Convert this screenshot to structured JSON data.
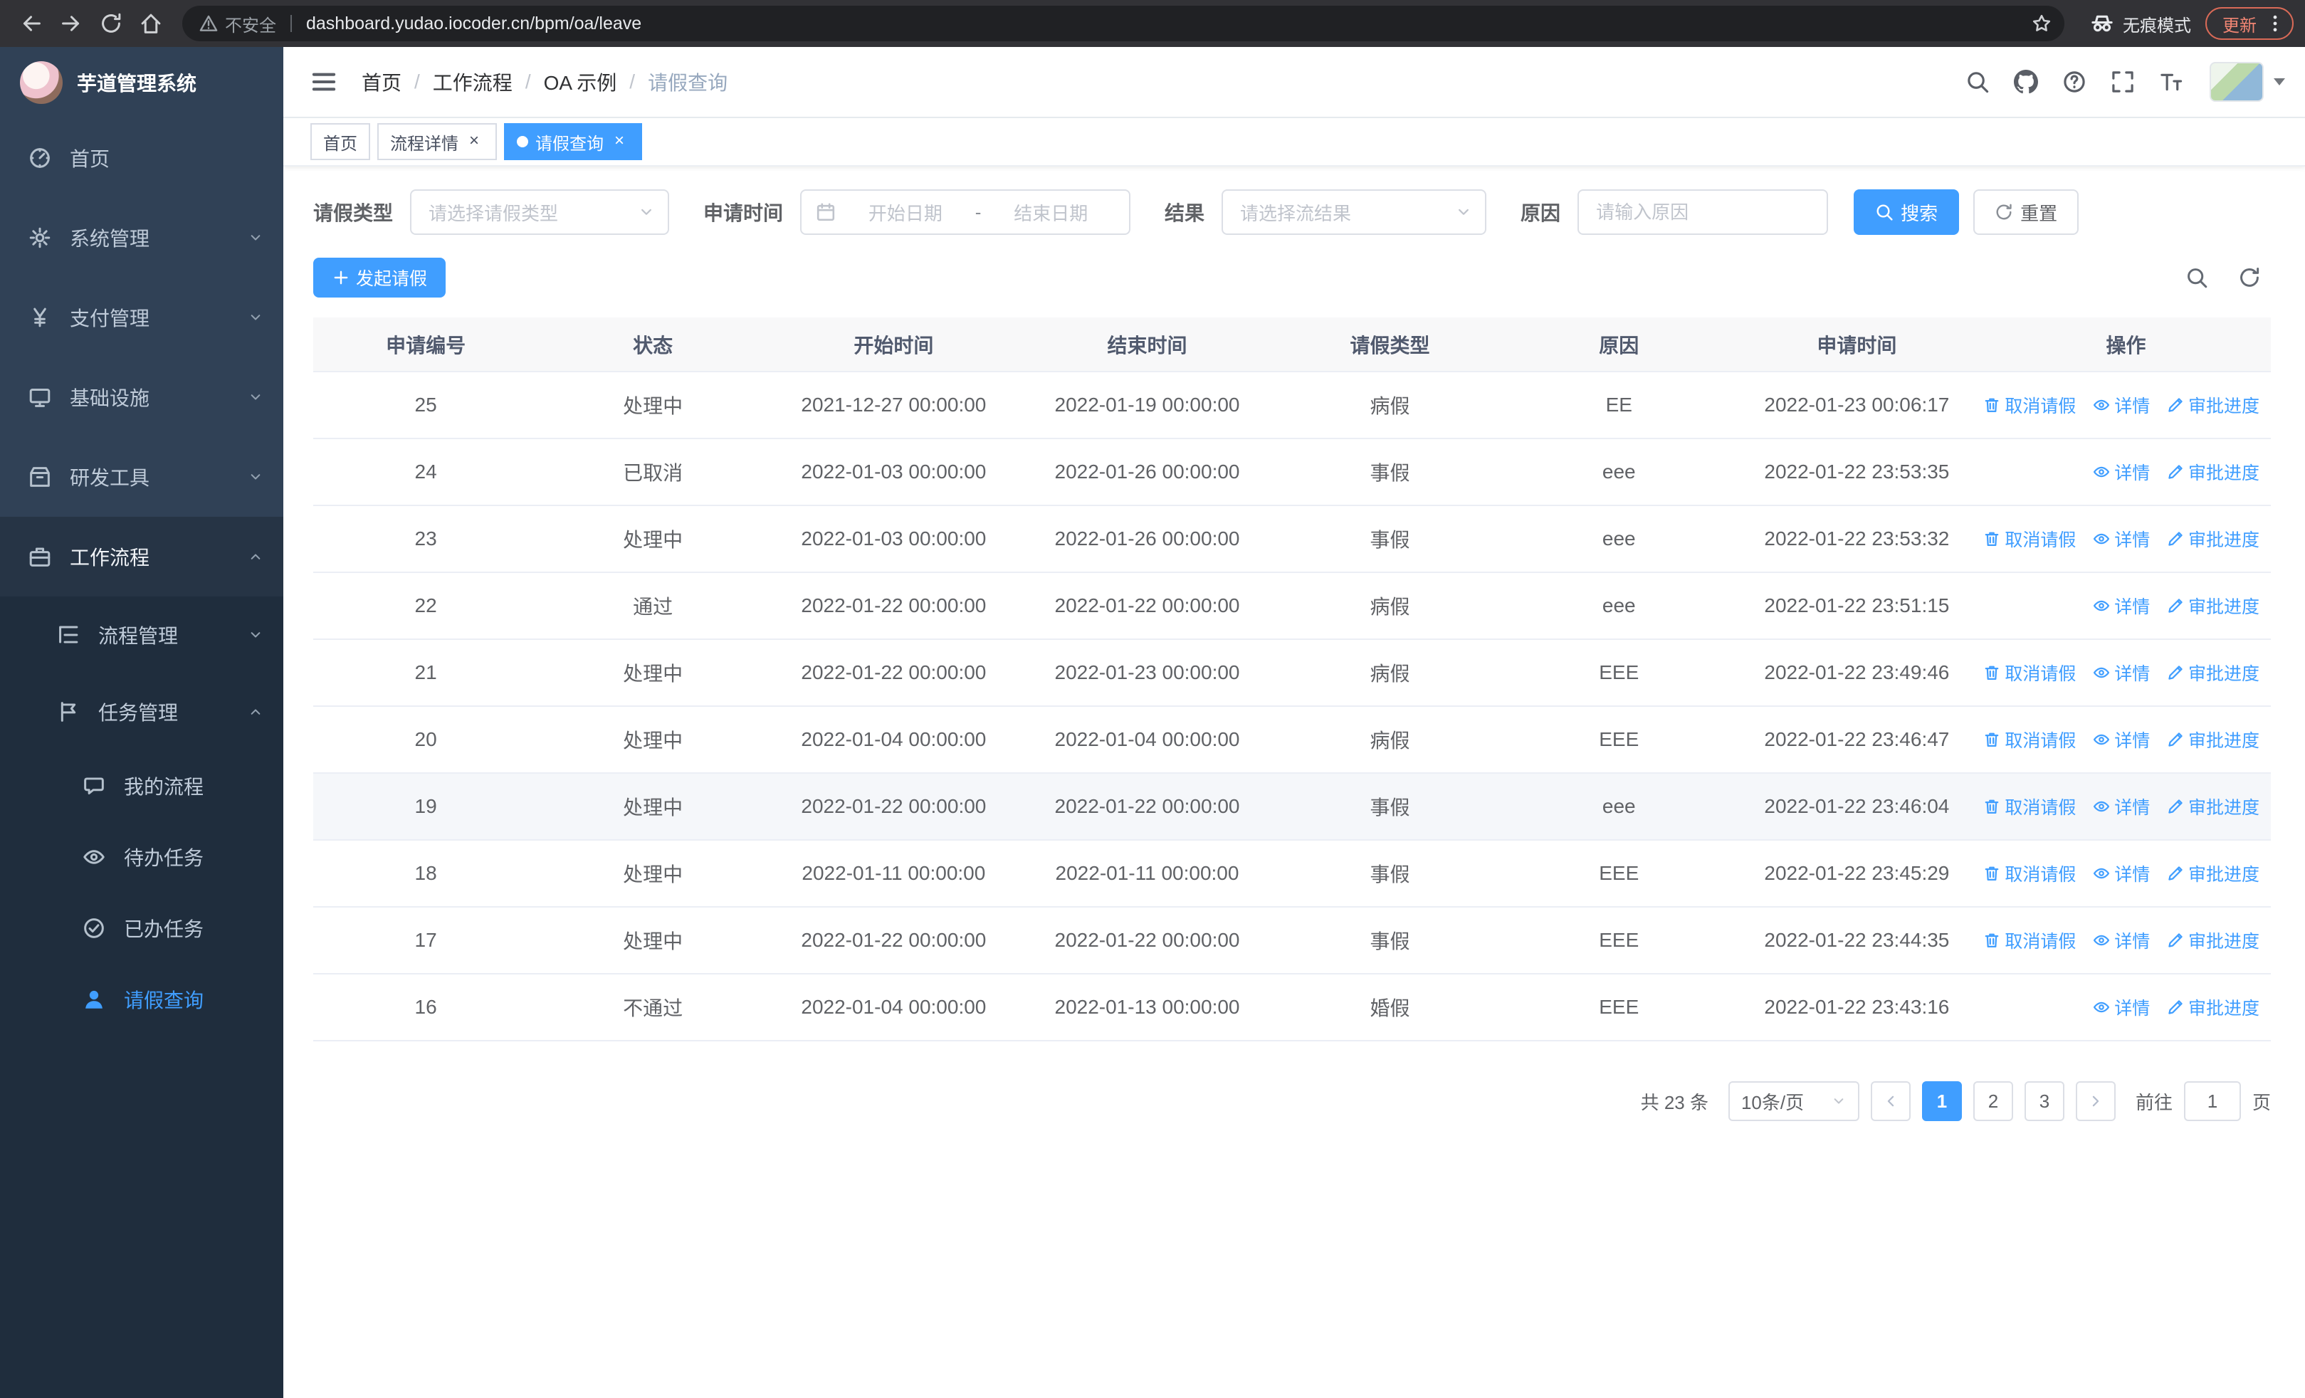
{
  "browser": {
    "security_label": "不安全",
    "url": "dashboard.yudao.iocoder.cn/bpm/oa/leave",
    "incognito_label": "无痕模式",
    "update_label": "更新"
  },
  "sidebar": {
    "title": "芋道管理系统",
    "items": [
      {
        "label": "首页"
      },
      {
        "label": "系统管理"
      },
      {
        "label": "支付管理"
      },
      {
        "label": "基础设施"
      },
      {
        "label": "研发工具"
      },
      {
        "label": "工作流程"
      },
      {
        "label": "流程管理"
      },
      {
        "label": "任务管理"
      },
      {
        "label": "我的流程"
      },
      {
        "label": "待办任务"
      },
      {
        "label": "已办任务"
      },
      {
        "label": "请假查询"
      }
    ]
  },
  "header": {
    "separator": "/",
    "breadcrumb": [
      {
        "label": "首页"
      },
      {
        "label": "工作流程"
      },
      {
        "label": "OA 示例"
      },
      {
        "label": "请假查询"
      }
    ]
  },
  "tabs": [
    {
      "label": "首页"
    },
    {
      "label": "流程详情"
    },
    {
      "label": "请假查询"
    }
  ],
  "ui": {
    "close_glyph": "×"
  },
  "filters": {
    "leave_type_label": "请假类型",
    "leave_type_placeholder": "请选择请假类型",
    "apply_time_label": "申请时间",
    "start_date_placeholder": "开始日期",
    "range_separator": "-",
    "end_date_placeholder": "结束日期",
    "result_label": "结果",
    "result_placeholder": "请选择流结果",
    "reason_label": "原因",
    "reason_placeholder": "请输入原因",
    "search_label": "搜索",
    "reset_label": "重置"
  },
  "toolbar": {
    "create_label": "发起请假"
  },
  "table": {
    "columns": [
      "申请编号",
      "状态",
      "开始时间",
      "结束时间",
      "请假类型",
      "原因",
      "申请时间",
      "操作"
    ],
    "actions": {
      "cancel": "取消请假",
      "detail": "详情",
      "progress": "审批进度"
    },
    "rows": [
      {
        "id": "25",
        "status": "处理中",
        "start": "2021-12-27 00:00:00",
        "end": "2022-01-19 00:00:00",
        "type": "病假",
        "reason": "EE",
        "applied": "2022-01-23 00:06:17"
      },
      {
        "id": "24",
        "status": "已取消",
        "start": "2022-01-03 00:00:00",
        "end": "2022-01-26 00:00:00",
        "type": "事假",
        "reason": "eee",
        "applied": "2022-01-22 23:53:35"
      },
      {
        "id": "23",
        "status": "处理中",
        "start": "2022-01-03 00:00:00",
        "end": "2022-01-26 00:00:00",
        "type": "事假",
        "reason": "eee",
        "applied": "2022-01-22 23:53:32"
      },
      {
        "id": "22",
        "status": "通过",
        "start": "2022-01-22 00:00:00",
        "end": "2022-01-22 00:00:00",
        "type": "病假",
        "reason": "eee",
        "applied": "2022-01-22 23:51:15"
      },
      {
        "id": "21",
        "status": "处理中",
        "start": "2022-01-22 00:00:00",
        "end": "2022-01-23 00:00:00",
        "type": "病假",
        "reason": "EEE",
        "applied": "2022-01-22 23:49:46"
      },
      {
        "id": "20",
        "status": "处理中",
        "start": "2022-01-04 00:00:00",
        "end": "2022-01-04 00:00:00",
        "type": "病假",
        "reason": "EEE",
        "applied": "2022-01-22 23:46:47"
      },
      {
        "id": "19",
        "status": "处理中",
        "start": "2022-01-22 00:00:00",
        "end": "2022-01-22 00:00:00",
        "type": "事假",
        "reason": "eee",
        "applied": "2022-01-22 23:46:04"
      },
      {
        "id": "18",
        "status": "处理中",
        "start": "2022-01-11 00:00:00",
        "end": "2022-01-11 00:00:00",
        "type": "事假",
        "reason": "EEE",
        "applied": "2022-01-22 23:45:29"
      },
      {
        "id": "17",
        "status": "处理中",
        "start": "2022-01-22 00:00:00",
        "end": "2022-01-22 00:00:00",
        "type": "事假",
        "reason": "EEE",
        "applied": "2022-01-22 23:44:35"
      },
      {
        "id": "16",
        "status": "不通过",
        "start": "2022-01-04 00:00:00",
        "end": "2022-01-13 00:00:00",
        "type": "婚假",
        "reason": "EEE",
        "applied": "2022-01-22 23:43:16"
      }
    ]
  },
  "pagination": {
    "total_text": "共 23 条",
    "page_size": "10条/页",
    "pages": [
      "1",
      "2",
      "3"
    ],
    "active_page": "1",
    "goto_label": "前往",
    "goto_value": "1",
    "page_unit": "页"
  },
  "colors": {
    "primary": "#409eff",
    "sidebar_bg": "#304156",
    "sidebar_submenu_bg": "#1f2d3d",
    "update_accent": "#f08573"
  }
}
